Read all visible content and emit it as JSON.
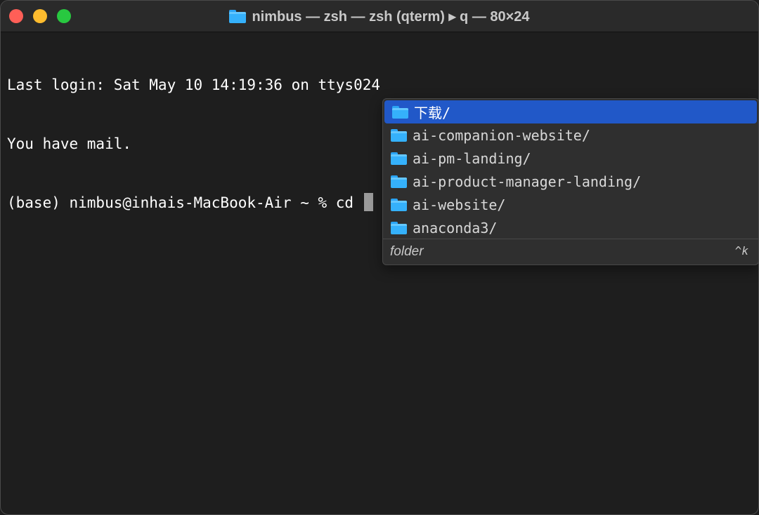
{
  "window": {
    "title": "nimbus — zsh — zsh (qterm) ▸ q — 80×24",
    "title_icon": "folder-icon"
  },
  "terminal": {
    "lines": [
      "Last login: Sat May 10 14:19:36 on ttys024",
      "You have mail.",
      "(base) nimbus@inhais-MacBook-Air ~ % cd "
    ]
  },
  "autocomplete": {
    "items": [
      {
        "label": "下载/",
        "icon": "folder-icon",
        "selected": true
      },
      {
        "label": "ai-companion-website/",
        "icon": "folder-icon",
        "selected": false
      },
      {
        "label": "ai-pm-landing/",
        "icon": "folder-icon",
        "selected": false
      },
      {
        "label": "ai-product-manager-landing/",
        "icon": "folder-icon",
        "selected": false
      },
      {
        "label": "ai-website/",
        "icon": "folder-icon",
        "selected": false
      },
      {
        "label": "anaconda3/",
        "icon": "folder-icon",
        "selected": false
      }
    ],
    "description": "folder",
    "shortcut_hint": "^k"
  },
  "colors": {
    "close": "#ff5f57",
    "minimize": "#febc2e",
    "maximize": "#28c840",
    "selection": "#2158c8",
    "terminal_bg": "#1e1e1e"
  }
}
